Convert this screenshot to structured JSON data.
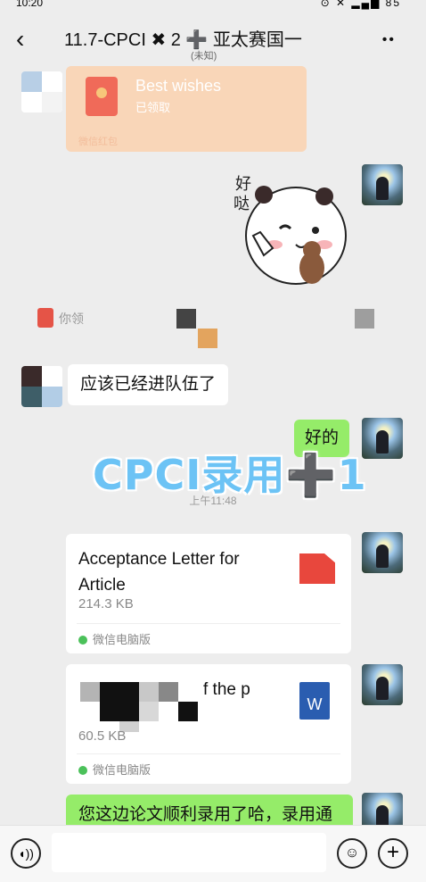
{
  "status": {
    "time": "10:20",
    "icons": "⊙ ✕ ▂▄▆ 85"
  },
  "header": {
    "back_icon": "back-arrow-icon",
    "title": "11.7-CPCI ✖ 2 ➕ 亚太赛国一",
    "subtitle": "(未知)",
    "more_icon": "more-dots-icon"
  },
  "messages": {
    "red_packet": {
      "title": "Best wishes",
      "status": "已领取",
      "footer": "微信红包"
    },
    "sticker_text": "好\n哒",
    "system_notice": "你领",
    "incoming_text": "应该已经进队伍了",
    "outgoing_reply": "好的",
    "overlay": "CPCI录用➕1",
    "timestamp": "上午11:48",
    "file1": {
      "name": "Acceptance Letter for Article",
      "size": "214.3 KB",
      "source": "微信电脑版",
      "type": "pdf"
    },
    "file2": {
      "name": "f the p",
      "size": "60.5 KB",
      "source": "微信电脑版",
      "type": "word",
      "icon_letter": "W"
    },
    "last_outgoing": "您这边论文顺利录用了哈，录用通"
  },
  "composer": {
    "voice_icon": "voice-icon",
    "emoji_icon": "emoji-icon",
    "plus_icon": "plus-icon",
    "plus_glyph": "+",
    "voice_glyph": "◖))",
    "emoji_glyph": "☺"
  },
  "colors": {
    "bubble_out": "#95ec69",
    "background": "#ededed",
    "overlay": "#6cc3f5"
  }
}
